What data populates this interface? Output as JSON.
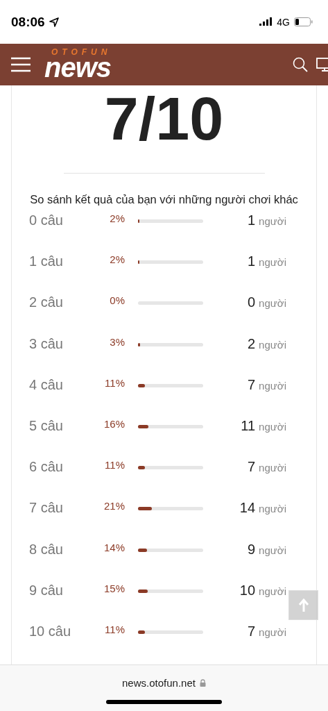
{
  "status_bar": {
    "time": "08:06",
    "network": "4G"
  },
  "header": {
    "logo_top": "OTOFUN",
    "logo_main": "news"
  },
  "score": "7/10",
  "comparison_title": "So sánh kết quả của bạn với những người chơi khác",
  "results": [
    {
      "label": "0 câu",
      "percent": "2%",
      "level": 0.02,
      "count": "1",
      "unit": "người"
    },
    {
      "label": "1 câu",
      "percent": "2%",
      "level": 0.02,
      "count": "1",
      "unit": "người"
    },
    {
      "label": "2 câu",
      "percent": "0%",
      "level": 0,
      "count": "0",
      "unit": "người"
    },
    {
      "label": "3 câu",
      "percent": "3%",
      "level": 0.03,
      "count": "2",
      "unit": "người"
    },
    {
      "label": "4 câu",
      "percent": "11%",
      "level": 0.11,
      "count": "7",
      "unit": "người"
    },
    {
      "label": "5 câu",
      "percent": "16%",
      "level": 0.16,
      "count": "11",
      "unit": "người"
    },
    {
      "label": "6 câu",
      "percent": "11%",
      "level": 0.11,
      "count": "7",
      "unit": "người"
    },
    {
      "label": "7 câu",
      "percent": "21%",
      "level": 0.21,
      "count": "14",
      "unit": "người"
    },
    {
      "label": "8 câu",
      "percent": "14%",
      "level": 0.14,
      "count": "9",
      "unit": "người"
    },
    {
      "label": "9 câu",
      "percent": "15%",
      "level": 0.15,
      "count": "10",
      "unit": "người"
    },
    {
      "label": "10 câu",
      "percent": "11%",
      "level": 0.11,
      "count": "7",
      "unit": "người"
    }
  ],
  "browser": {
    "url": "news.otofun.net"
  }
}
